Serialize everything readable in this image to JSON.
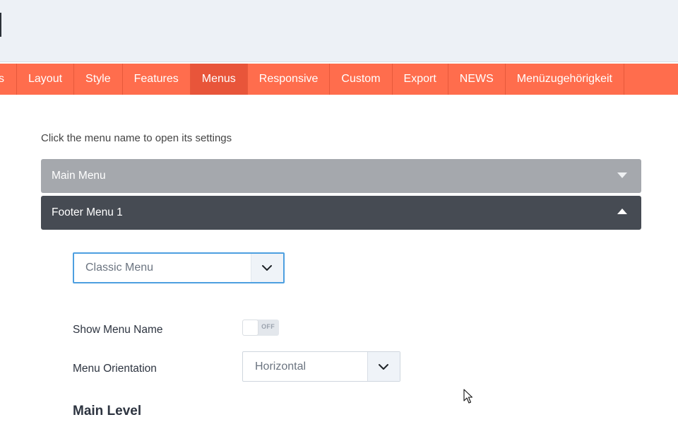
{
  "tabs": [
    {
      "label": "s",
      "active": false
    },
    {
      "label": "Layout",
      "active": false
    },
    {
      "label": "Style",
      "active": false
    },
    {
      "label": "Features",
      "active": false
    },
    {
      "label": "Menus",
      "active": true
    },
    {
      "label": "Responsive",
      "active": false
    },
    {
      "label": "Custom",
      "active": false
    },
    {
      "label": "Export",
      "active": false
    },
    {
      "label": "NEWS",
      "active": false
    },
    {
      "label": "Menüzugehörigkeit",
      "active": false
    }
  ],
  "hint": "Click the menu name to open its settings",
  "menus": {
    "main": "Main Menu",
    "footer": "Footer Menu 1"
  },
  "settings": {
    "menu_type": "Classic Menu",
    "show_menu_name_label": "Show Menu Name",
    "toggle_state": "OFF",
    "orientation_label": "Menu Orientation",
    "orientation_value": "Horizontal",
    "section_heading": "Main Level"
  },
  "colors": {
    "accent": "#ff6d4d",
    "accent_active": "#e8553a",
    "main_menu_bar": "#a5a8ad",
    "footer_menu_bar": "#464b53",
    "select_focus": "#4d9fe0"
  }
}
